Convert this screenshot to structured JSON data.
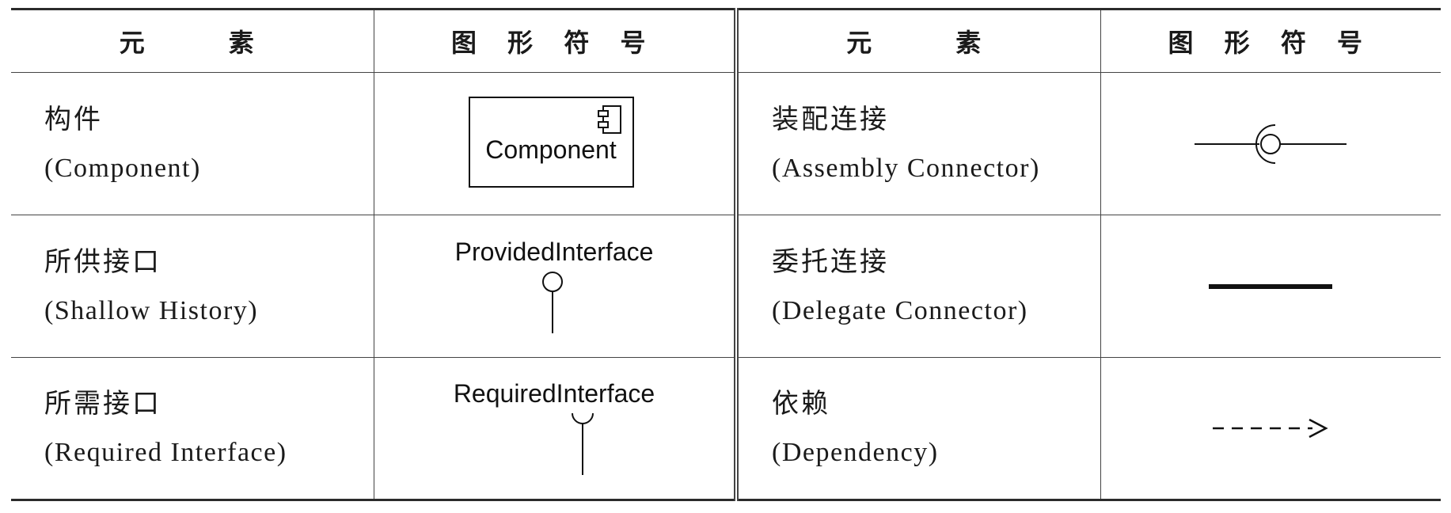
{
  "headers": {
    "element_left": "元　　素",
    "symbol_left": "图 形 符 号",
    "element_right": "元　　素",
    "symbol_right": "图 形 符 号"
  },
  "rows": [
    {
      "left": {
        "zh": "构件",
        "en": "(Component)",
        "symbol_icon": "component-icon",
        "symbol_text": "Component"
      },
      "right": {
        "zh": "装配连接",
        "en": "(Assembly Connector)",
        "symbol_icon": "assembly-connector-icon"
      }
    },
    {
      "left": {
        "zh": "所供接口",
        "en": "(Shallow History)",
        "symbol_icon": "provided-interface-icon",
        "symbol_text": "ProvidedInterface"
      },
      "right": {
        "zh": "委托连接",
        "en": "(Delegate Connector)",
        "symbol_icon": "delegate-connector-icon"
      }
    },
    {
      "left": {
        "zh": "所需接口",
        "en": "(Required Interface)",
        "symbol_icon": "required-interface-icon",
        "symbol_text": "RequiredInterface"
      },
      "right": {
        "zh": "依赖",
        "en": "(Dependency)",
        "symbol_icon": "dependency-arrow-icon"
      }
    }
  ]
}
